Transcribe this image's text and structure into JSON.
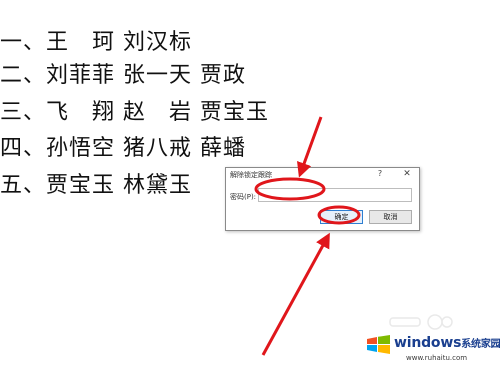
{
  "document": {
    "lines": [
      "一、王　珂 刘汉标",
      "二、刘菲菲 张一天 贾政",
      "三、飞　翔 赵　岩 贾宝玉",
      "四、孙悟空 猪八戒 薛蟠",
      "五、贾宝玉 林黛玉"
    ]
  },
  "dialog": {
    "title": "解除锁定跟踪",
    "help_label": "?",
    "close_label": "✕",
    "password_label": "密码(P):",
    "password_value": "",
    "ok_label": "确定",
    "cancel_label": "取消"
  },
  "annotation": {
    "color": "#e0161b"
  },
  "watermark": {
    "main": "windows",
    "sub": "系统家园",
    "url": "www.ruhaitu.com"
  }
}
